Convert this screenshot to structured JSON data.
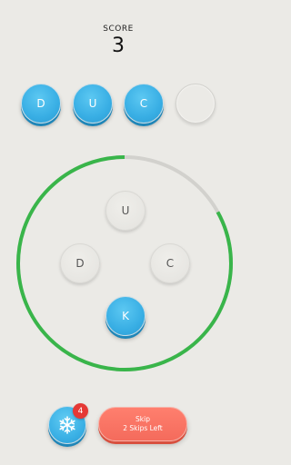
{
  "score": {
    "label": "SCORE",
    "value": "3"
  },
  "slots": [
    {
      "letter": "D",
      "filled": true
    },
    {
      "letter": "U",
      "filled": true
    },
    {
      "letter": "C",
      "filled": true
    },
    {
      "letter": "",
      "filled": false
    }
  ],
  "timer": {
    "fraction_remaining": 0.83,
    "color_remaining": "#39b54a",
    "color_track": "#d2d1cd"
  },
  "letters": {
    "top": "U",
    "left": "D",
    "right": "C",
    "bottom": "K"
  },
  "powerups": {
    "freeze_icon": "snowflake-icon",
    "freeze_count": "4",
    "skip_line1": "Skip",
    "skip_line2": "2 Skips Left"
  },
  "colors": {
    "accent_blue": "#38aee4",
    "skip_red": "#f46b5c",
    "badge_red": "#e53935"
  }
}
